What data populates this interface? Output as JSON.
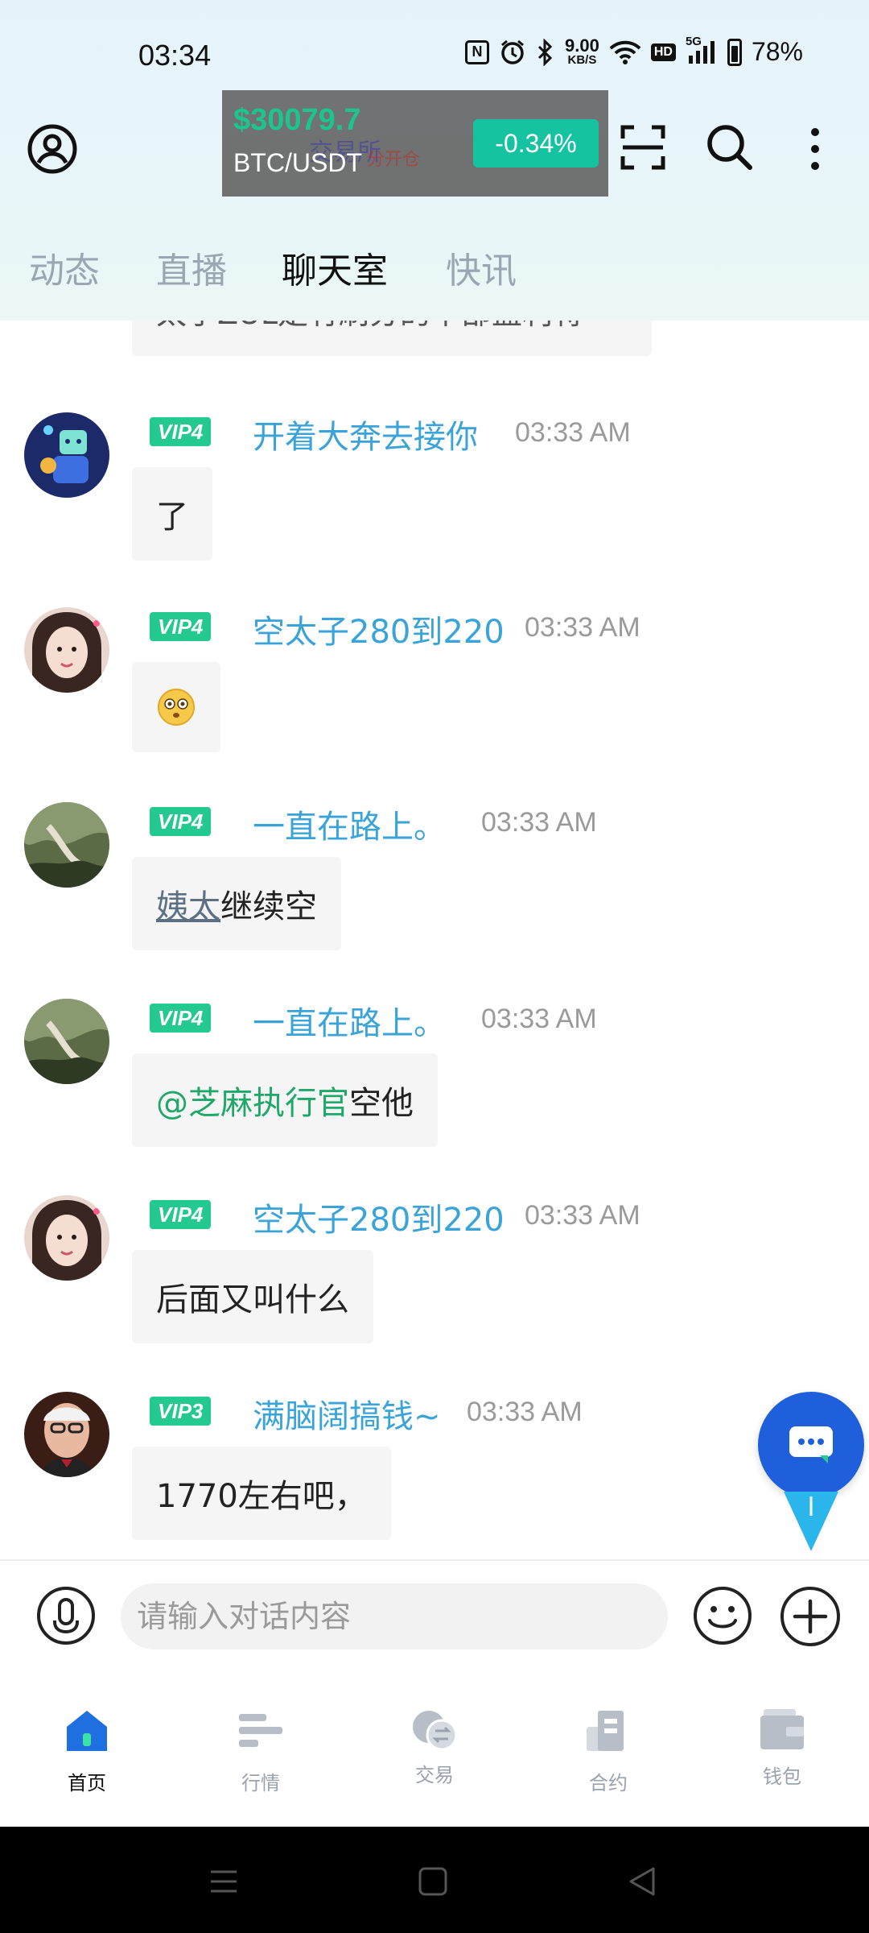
{
  "status_bar": {
    "time": "03:34",
    "nfc_label": "N",
    "net_speed_value": "9.00",
    "net_speed_unit": "KB/S",
    "hd_label": "HD",
    "signal_label": "5G",
    "battery": "78%"
  },
  "header": {
    "ticker": {
      "price": "$30079.7",
      "pair": "BTC/USDT",
      "change": "-0.34%",
      "overlay_text": "交易所",
      "overlay_text2": "分开仓"
    }
  },
  "tabs": [
    {
      "label": "动态",
      "active": false
    },
    {
      "label": "直播",
      "active": false
    },
    {
      "label": "聊天室",
      "active": true
    },
    {
      "label": "快讯",
      "active": false
    }
  ],
  "chat": {
    "partial_text": "太子ZUL是有刷分的中部蓝利将",
    "messages": [
      {
        "vip": "VIP4",
        "username": "开着大奔去接你",
        "time": "03:33 AM",
        "text": "了"
      },
      {
        "vip": "VIP4",
        "username": "空太子280到220",
        "time": "03:33 AM",
        "emoji": "😳"
      },
      {
        "vip": "VIP4",
        "username": "一直在路上。",
        "time": "03:33 AM",
        "link": "姨太",
        "text": "继续空"
      },
      {
        "vip": "VIP4",
        "username": "一直在路上。",
        "time": "03:33 AM",
        "mention": "@芝麻执行官",
        "text": "空他"
      },
      {
        "vip": "VIP4",
        "username": "空太子280到220",
        "time": "03:33 AM",
        "text": "后面又叫什么"
      },
      {
        "vip": "VIP3",
        "username": "满脑阔搞钱~",
        "time": "03:33 AM",
        "text": "1770左右吧，"
      }
    ]
  },
  "input_bar": {
    "placeholder": "请输入对话内容"
  },
  "bottom_nav": [
    {
      "label": "首页",
      "icon": "home-icon",
      "active": true
    },
    {
      "label": "行情",
      "icon": "market-icon",
      "active": false
    },
    {
      "label": "交易",
      "icon": "trade-icon",
      "active": false
    },
    {
      "label": "合约",
      "icon": "contract-icon",
      "active": false
    },
    {
      "label": "钱包",
      "icon": "wallet-icon",
      "active": false
    }
  ],
  "colors": {
    "accent_green": "#23c98f",
    "username_blue": "#3aa3d8",
    "fab_blue": "#1f5fdb",
    "change_teal": "#16c3a0"
  }
}
